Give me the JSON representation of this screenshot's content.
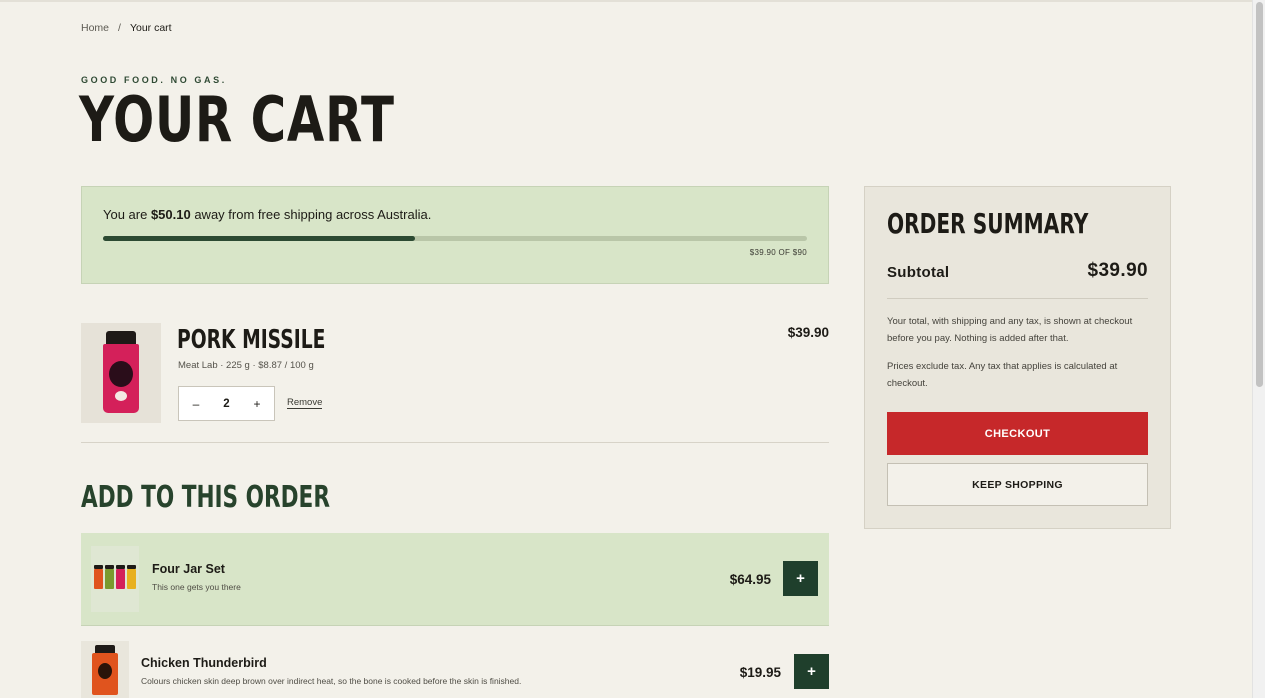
{
  "breadcrumb": {
    "home": "Home",
    "separator": "/",
    "current": "Your cart"
  },
  "header": {
    "eyebrow": "GOOD FOOD. NO GAS.",
    "title": "YOUR CART"
  },
  "shipping": {
    "prefix": "You are ",
    "amount": "$50.10",
    "suffix": " away from free shipping across Australia.",
    "progress_label": "$39.90 OF $90",
    "progress_fraction": 0.4433
  },
  "cart_items": [
    {
      "name": "PORK MISSILE",
      "price": "$39.90",
      "meta": "Meat Lab · 225 g · $8.87 / 100 g",
      "quantity": "2",
      "decrement": "–",
      "increment": "+",
      "remove": "Remove"
    }
  ],
  "upsell": {
    "title": "ADD TO THIS ORDER",
    "items": [
      {
        "name": "Four Jar Set",
        "description": "This one gets you there",
        "price": "$64.95",
        "add": "+"
      },
      {
        "name": "Chicken Thunderbird",
        "description": "Colours chicken skin deep brown over indirect heat, so the bone is cooked before the skin is finished.",
        "price": "$19.95",
        "add": "+"
      }
    ]
  },
  "summary": {
    "title": "ORDER SUMMARY",
    "subtotal_label": "Subtotal",
    "subtotal_value": "$39.90",
    "note_1": "Your total, with shipping and any tax, is shown at checkout before you pay. Nothing is added after that.",
    "note_2": "Prices exclude tax. Any tax that applies is calculated at checkout.",
    "checkout_label": "CHECKOUT",
    "keep_shopping_label": "KEEP SHOPPING"
  },
  "colors": {
    "background": "#f3f1ea",
    "green_panel": "#d8e5c8",
    "dark_green": "#1f3f2c",
    "checkout_red": "#c6282a"
  }
}
